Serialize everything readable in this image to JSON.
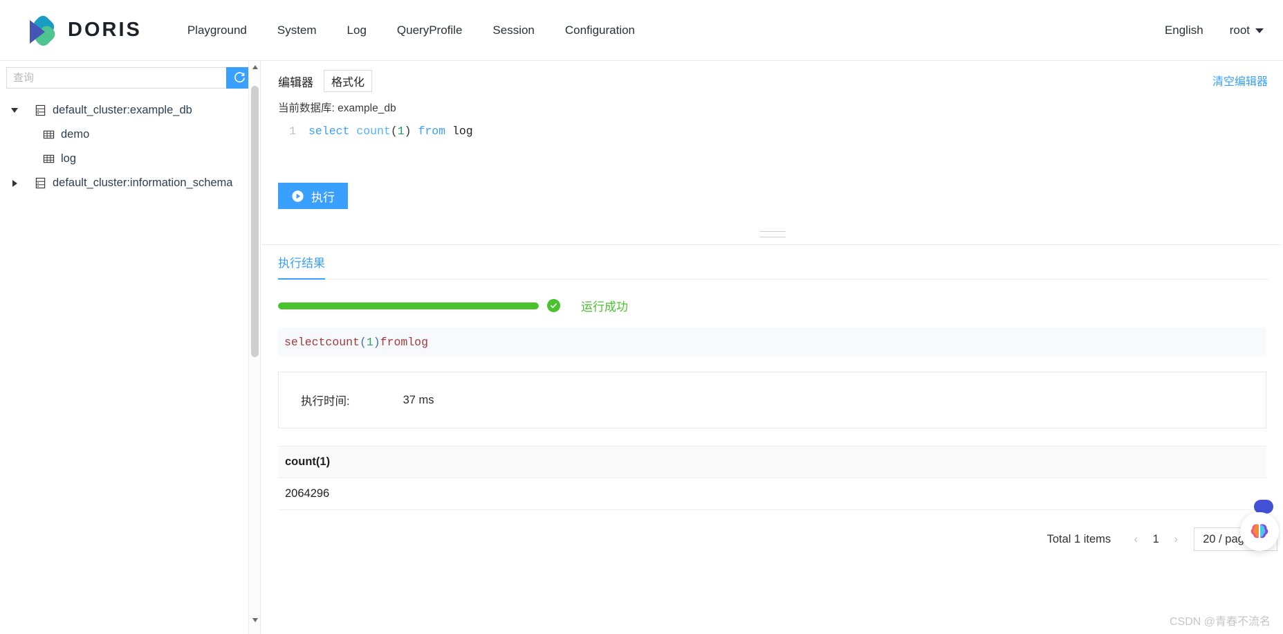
{
  "topnav": {
    "brand": "DORIS",
    "logo_icon": "doris-logo-icon",
    "links": [
      {
        "label": "Playground"
      },
      {
        "label": "System"
      },
      {
        "label": "Log"
      },
      {
        "label": "QueryProfile"
      },
      {
        "label": "Session"
      },
      {
        "label": "Configuration"
      }
    ],
    "language": "English",
    "user": "root",
    "user_caret_icon": "chevron-down-icon"
  },
  "sidebar": {
    "search_placeholder": "查询",
    "search_value": "",
    "refresh_icon": "refresh-icon",
    "tree": [
      {
        "label": "default_cluster:example_db",
        "expanded": true,
        "icon": "database-icon",
        "toggle_icon": "triangle-down-icon",
        "children": [
          {
            "label": "demo",
            "icon": "table-icon"
          },
          {
            "label": "log",
            "icon": "table-icon"
          }
        ]
      },
      {
        "label": "default_cluster:information_schema",
        "expanded": false,
        "icon": "database-icon",
        "toggle_icon": "triangle-right-icon",
        "children": []
      }
    ],
    "scroll_up_icon": "scroll-arrow-up-icon",
    "scroll_down_icon": "scroll-arrow-down-icon"
  },
  "editor": {
    "tab_label": "编辑器",
    "format_button": "格式化",
    "clear_link": "清空编辑器",
    "current_db_label": "当前数据库: example_db",
    "line_number": "1",
    "sql_tokens": {
      "kw1": "select",
      "fn": "count",
      "open": "(",
      "num": "1",
      "close": ")",
      "kw2": "from",
      "id": "log"
    },
    "execute_button": "执行",
    "execute_icon": "play-circle-icon"
  },
  "results": {
    "tab_label": "执行结果",
    "progress_percent": 100,
    "status_icon": "check-circle-icon",
    "status_text": "运行成功",
    "status_color": "#4ac22c",
    "sql_echo": {
      "kw1": "select",
      "fn": "count",
      "open": "(",
      "num": "1",
      "close": ")",
      "kw2": "from",
      "id": "log"
    },
    "info": {
      "time_label": "执行时间:",
      "time_value": "37 ms"
    },
    "table": {
      "columns": [
        "count(1)"
      ],
      "rows": [
        [
          "2064296"
        ]
      ]
    },
    "pagination": {
      "total_text": "Total 1 items",
      "prev_icon": "chevron-left-icon",
      "page": "1",
      "next_icon": "chevron-right-icon",
      "page_size": "20 / page",
      "page_size_caret_icon": "chevron-down-icon"
    }
  },
  "floating": {
    "widget_icon": "brain-assistant-icon"
  },
  "watermark": "CSDN @青春不流名",
  "colors": {
    "accent": "#3aa0ff",
    "success": "#4ac22c",
    "border": "#e8e8e8"
  }
}
